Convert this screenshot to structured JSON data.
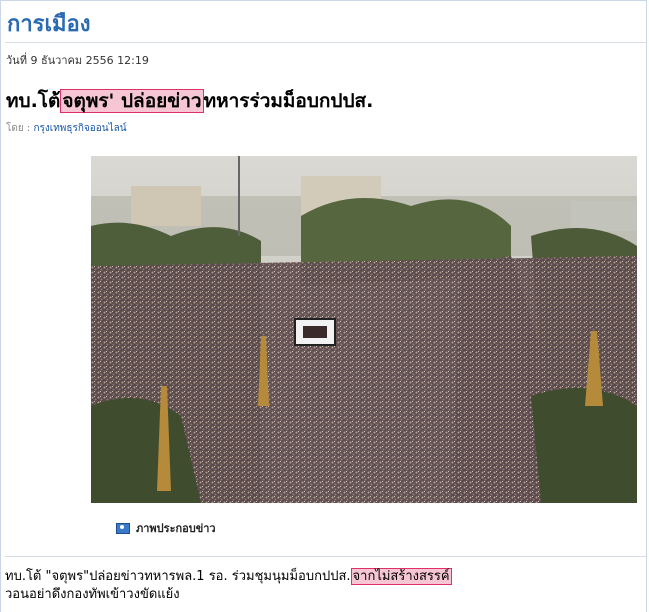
{
  "section": {
    "title": "การเมือง"
  },
  "article": {
    "date": "วันที่ 9 ธันวาคม 2556 12:19",
    "headline_prefix": "ทบ.โต้",
    "headline_highlight": "จตุพร' ปล่อยข่าว",
    "headline_suffix": "ทหารร่วมม็อบกปปส.",
    "byline_label": "โดย :",
    "byline_source": "กรุงเทพธุรกิจออนไลน์",
    "image_caption": "ภาพประกอบข่าว",
    "summary_prefix": "ทบ.โต้ \"จตุพร\"ปล่อยข่าวทหารพล.1 รอ. ร่วมชุมนุมม็อบกปปส.",
    "summary_highlight": "จากไม่สร้างสรรค์",
    "summary_line2": "วอนอย่าดึงกองทัพเข้าวงขัดแย้ง"
  },
  "colors": {
    "section_title": "#2a6ab3",
    "highlight_bg": "#f7c6d4",
    "highlight_border": "#e0306a",
    "link": "#1a56a8"
  }
}
